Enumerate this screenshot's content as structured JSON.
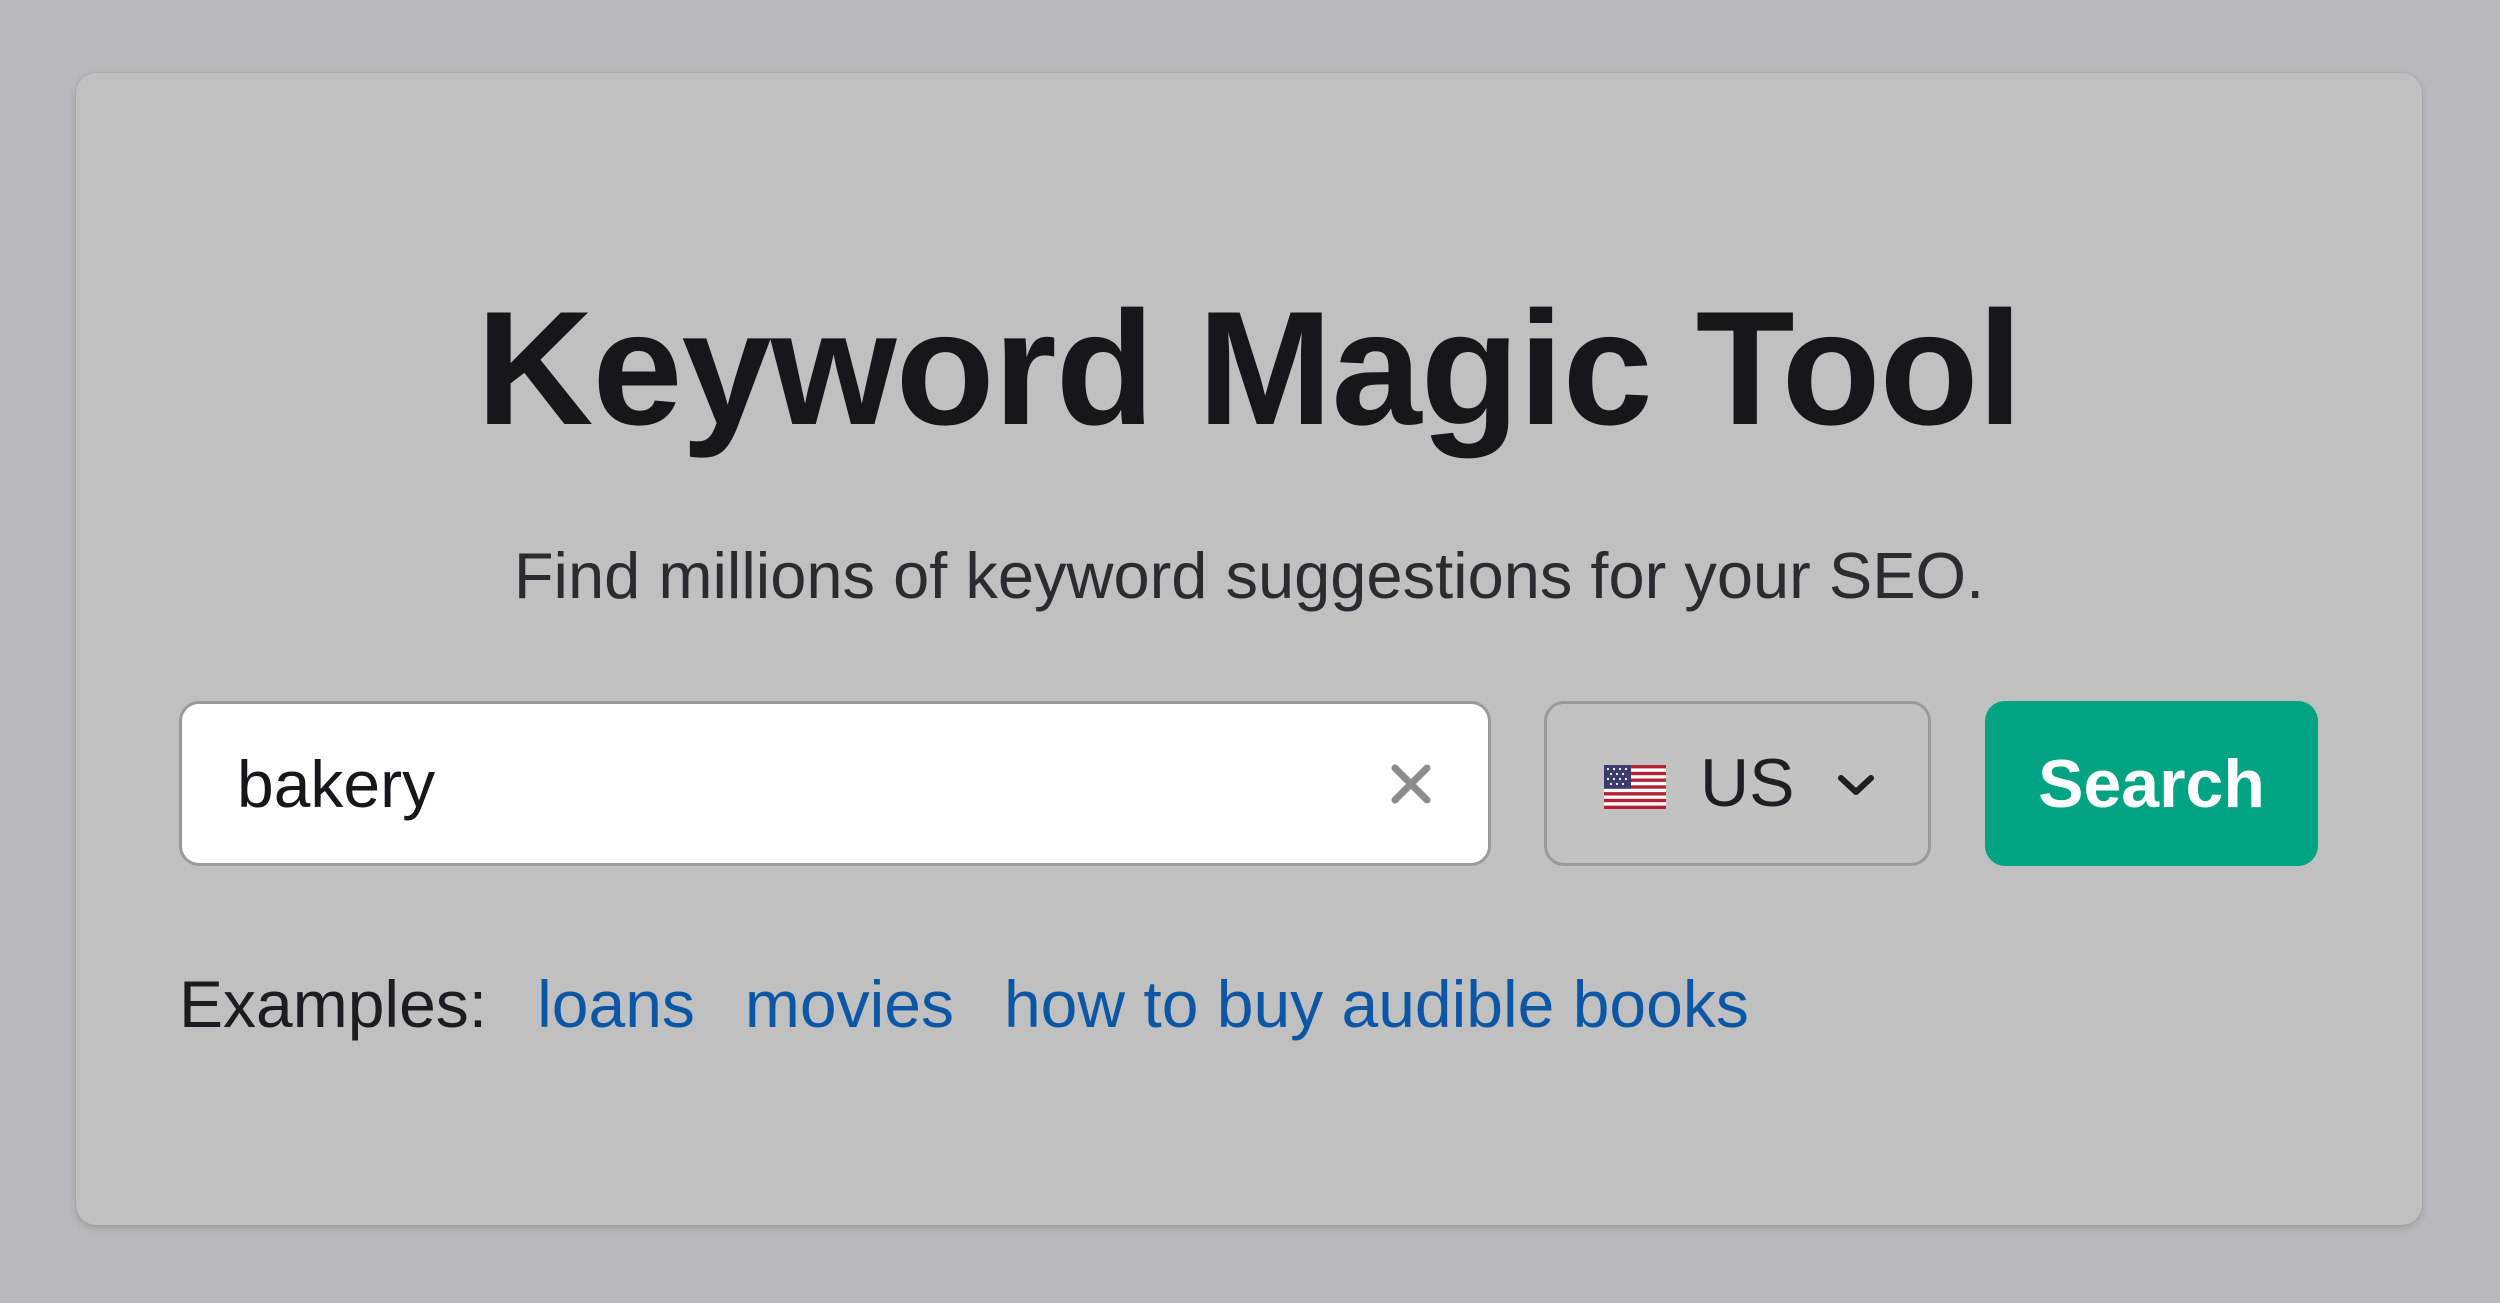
{
  "card": {
    "title": "Keyword Magic Tool",
    "subtitle": "Find millions of keyword suggestions for your SEO."
  },
  "search": {
    "value": "bakery",
    "clear_icon": "close-icon"
  },
  "country": {
    "flag_icon": "us-flag-icon",
    "code": "US",
    "dropdown_icon": "chevron-down-icon"
  },
  "search_button": {
    "label": "Search"
  },
  "examples": {
    "label": "Examples:",
    "links": [
      "loans",
      "movies",
      "how to buy audible books"
    ]
  },
  "colors": {
    "page_background": "#b8b9bc",
    "card_background": "#c0c0c0",
    "button": "#00a382",
    "link": "#0b56a5",
    "title": "#16171b"
  }
}
